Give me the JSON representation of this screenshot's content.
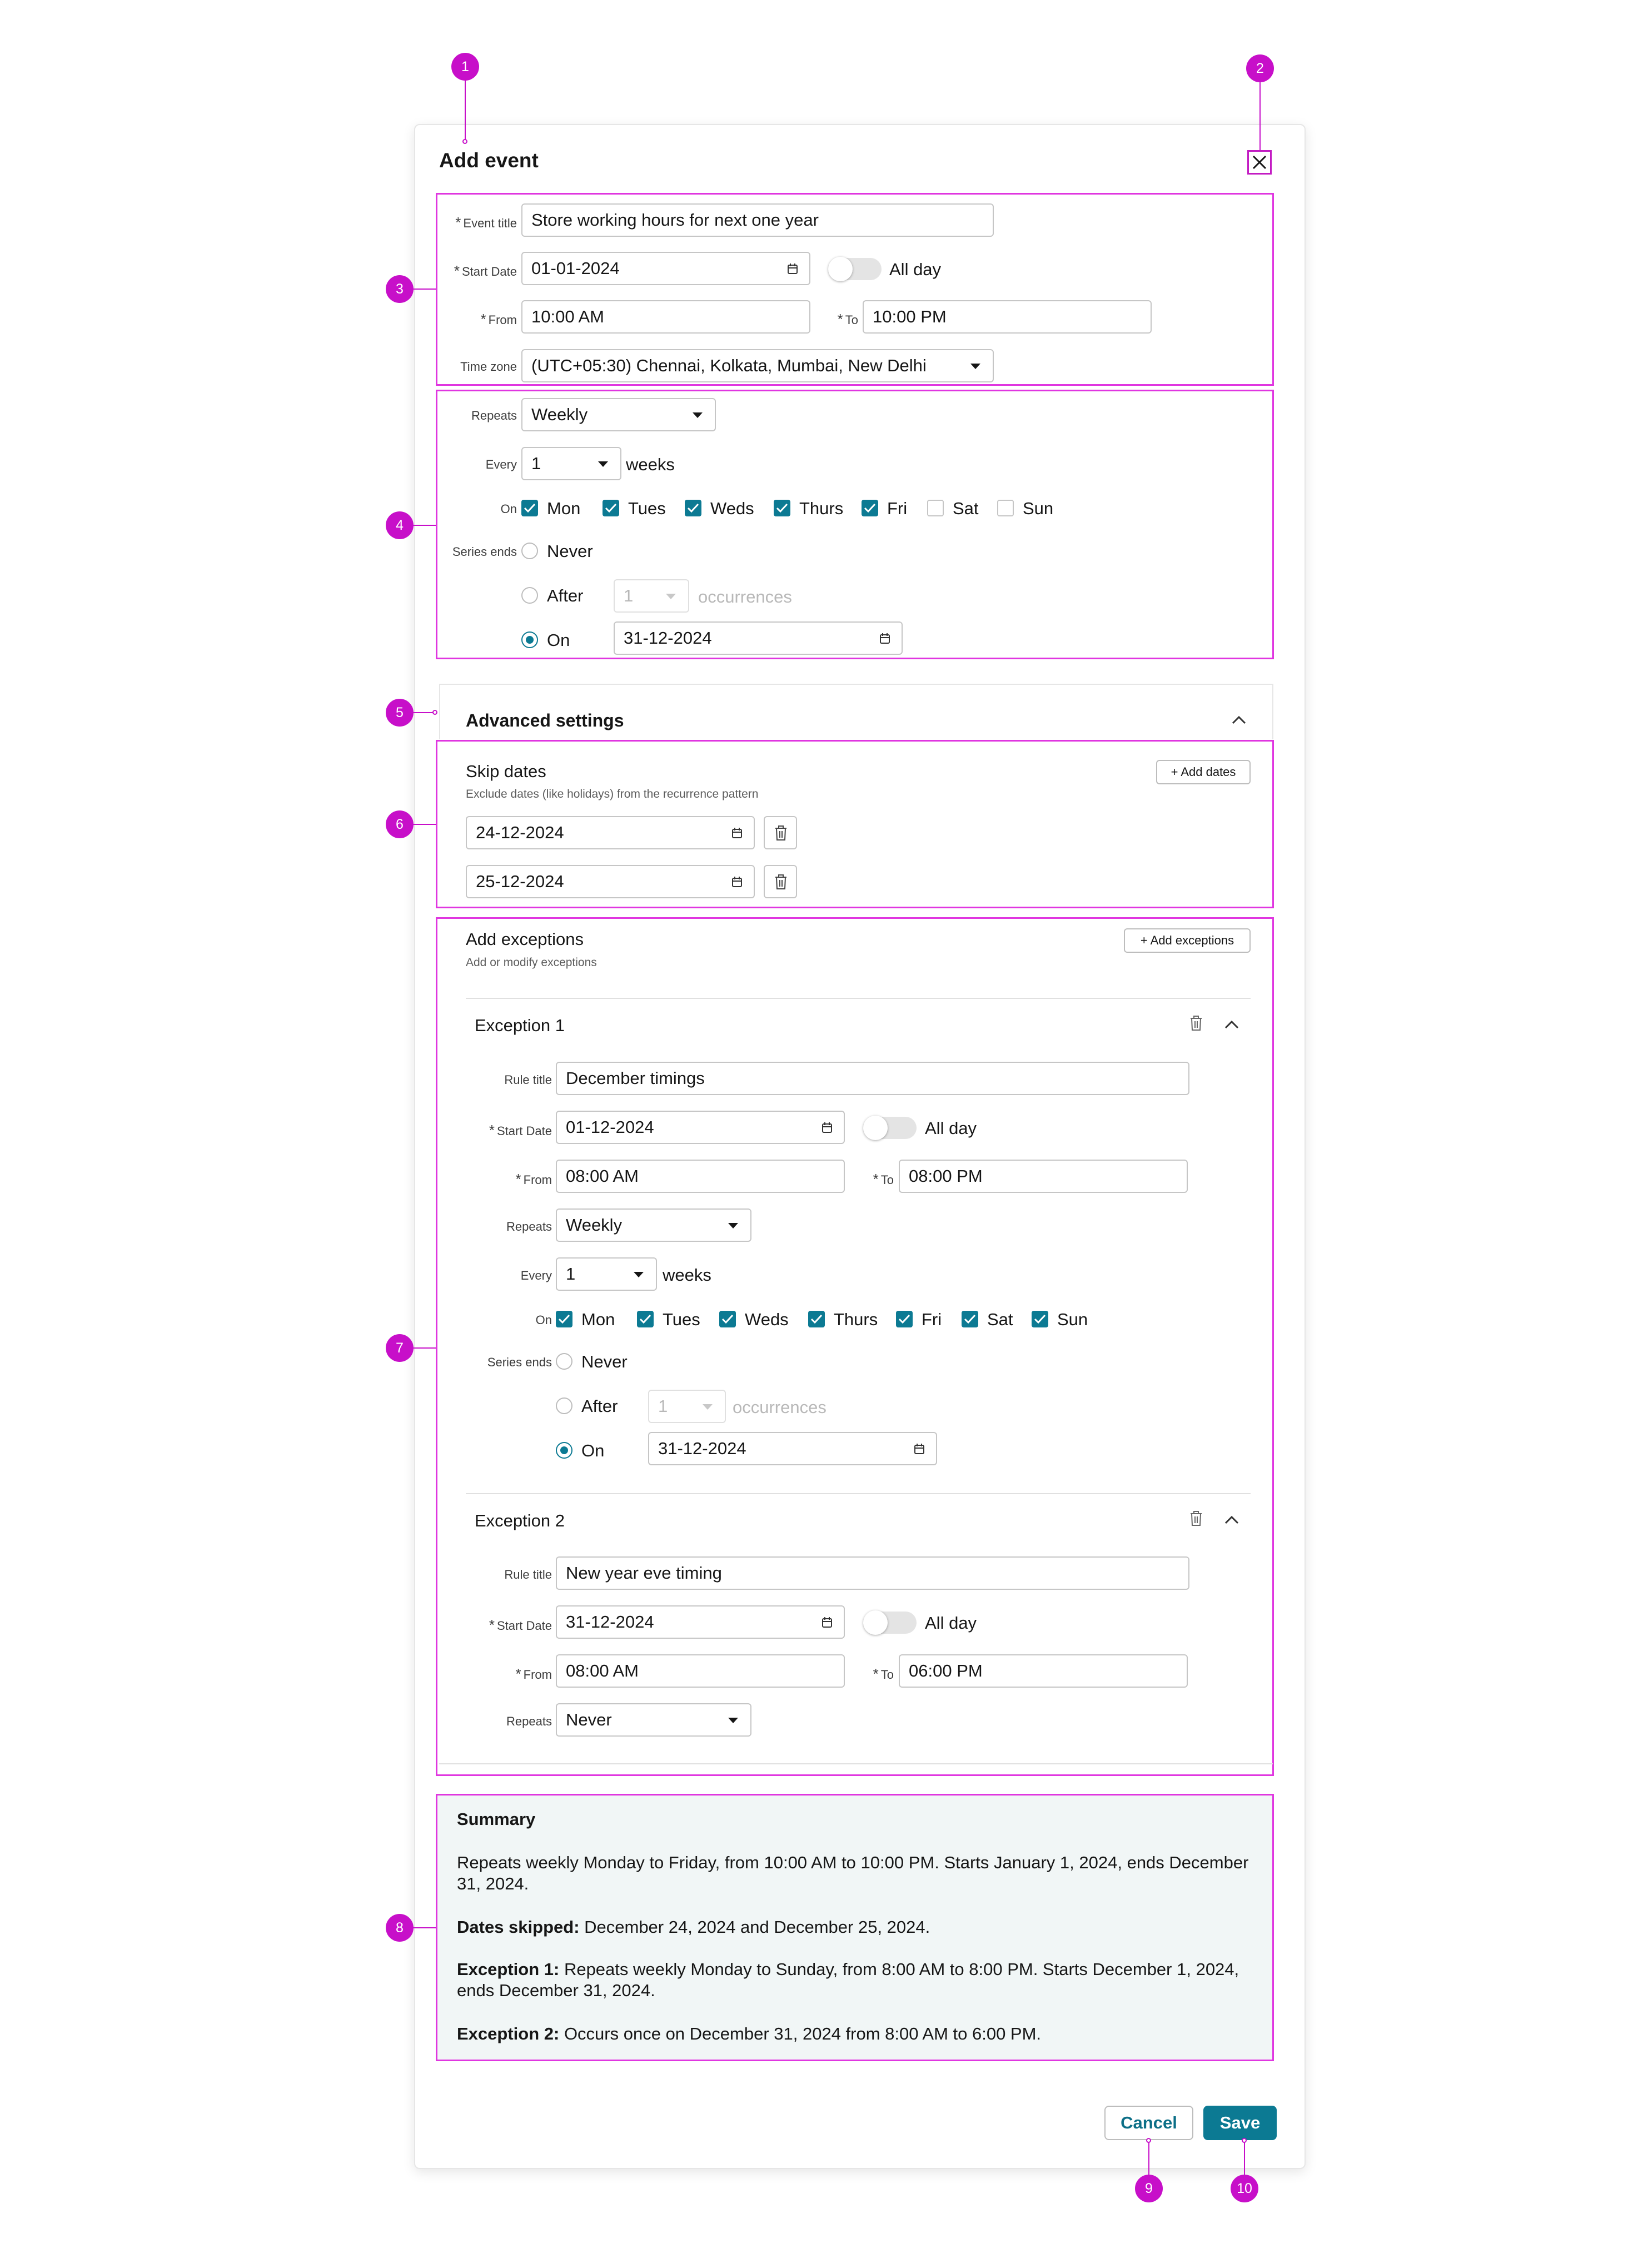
{
  "dialog": {
    "title": "Add event",
    "close_icon": "close-icon"
  },
  "event": {
    "title_label": "Event title",
    "title_value": "Store working hours for next one year",
    "start_date_label": "Start Date",
    "start_date_value": "01-01-2024",
    "all_day_label": "All day",
    "from_label": "From",
    "from_value": "10:00 AM",
    "to_label": "To",
    "to_value": "10:00 PM",
    "timezone_label": "Time zone",
    "timezone_value": "(UTC+05:30) Chennai, Kolkata, Mumbai, New Delhi"
  },
  "recurrence": {
    "repeats_label": "Repeats",
    "repeats_value": "Weekly",
    "every_label": "Every",
    "every_value": "1",
    "every_unit": "weeks",
    "on_label": "On",
    "days": [
      {
        "label": "Mon",
        "checked": true
      },
      {
        "label": "Tues",
        "checked": true
      },
      {
        "label": "Weds",
        "checked": true
      },
      {
        "label": "Thurs",
        "checked": true
      },
      {
        "label": "Fri",
        "checked": true
      },
      {
        "label": "Sat",
        "checked": false
      },
      {
        "label": "Sun",
        "checked": false
      }
    ],
    "series_ends_label": "Series ends",
    "never_label": "Never",
    "after_label": "After",
    "after_value": "1",
    "occurrences_label": "occurrences",
    "on_option_label": "On",
    "end_date_value": "31-12-2024",
    "selected_end": "on"
  },
  "advanced": {
    "title": "Advanced settings"
  },
  "skip_dates": {
    "title": "Skip dates",
    "helper": "Exclude dates (like holidays) from the recurrence pattern",
    "add_label": "+ Add dates",
    "dates": [
      "24-12-2024",
      "25-12-2024"
    ]
  },
  "exceptions": {
    "title": "Add exceptions",
    "helper": "Add or modify exceptions",
    "add_label": "+ Add exceptions",
    "items": [
      {
        "title": "Exception 1",
        "rule_title_label": "Rule title",
        "rule_title_value": "December timings",
        "start_date_label": "Start Date",
        "start_date_value": "01-12-2024",
        "all_day_label": "All day",
        "from_label": "From",
        "from_value": "08:00 AM",
        "to_label": "To",
        "to_value": "08:00 PM",
        "repeats_label": "Repeats",
        "repeats_value": "Weekly",
        "every_label": "Every",
        "every_value": "1",
        "every_unit": "weeks",
        "on_label": "On",
        "days": [
          {
            "label": "Mon",
            "checked": true
          },
          {
            "label": "Tues",
            "checked": true
          },
          {
            "label": "Weds",
            "checked": true
          },
          {
            "label": "Thurs",
            "checked": true
          },
          {
            "label": "Fri",
            "checked": true
          },
          {
            "label": "Sat",
            "checked": true
          },
          {
            "label": "Sun",
            "checked": true
          }
        ],
        "series_ends_label": "Series ends",
        "never_label": "Never",
        "after_label": "After",
        "after_value": "1",
        "occurrences_label": "occurrences",
        "on_option_label": "On",
        "end_date_value": "31-12-2024"
      },
      {
        "title": "Exception 2",
        "rule_title_label": "Rule title",
        "rule_title_value": "New year eve timing",
        "start_date_label": "Start Date",
        "start_date_value": "31-12-2024",
        "all_day_label": "All day",
        "from_label": "From",
        "from_value": "08:00 AM",
        "to_label": "To",
        "to_value": "06:00 PM",
        "repeats_label": "Repeats",
        "repeats_value": "Never"
      }
    ]
  },
  "summary": {
    "title": "Summary",
    "line1": "Repeats weekly Monday to Friday, from 10:00 AM to 10:00 PM. Starts January 1, 2024, ends December 31, 2024.",
    "dates_skipped_label": "Dates skipped:",
    "dates_skipped_text": " December 24, 2024 and December 25, 2024.",
    "exception1_label": "Exception 1:",
    "exception1_text": " Repeats weekly Monday to Sunday, from 8:00 AM to 8:00 PM. Starts December 1, 2024, ends December 31, 2024.",
    "exception2_label": "Exception 2:",
    "exception2_text": " Occurs once on December 31, 2024 from 8:00 AM to 6:00 PM."
  },
  "footer": {
    "cancel_label": "Cancel",
    "save_label": "Save"
  },
  "annotations": {
    "markers": [
      "1",
      "2",
      "3",
      "4",
      "5",
      "6",
      "7",
      "8",
      "9",
      "10"
    ],
    "color": "#c70fc9"
  },
  "colors": {
    "accent": "#0c7a93",
    "annotation": "#e036e0",
    "summary_bg": "#f1f6f6"
  }
}
